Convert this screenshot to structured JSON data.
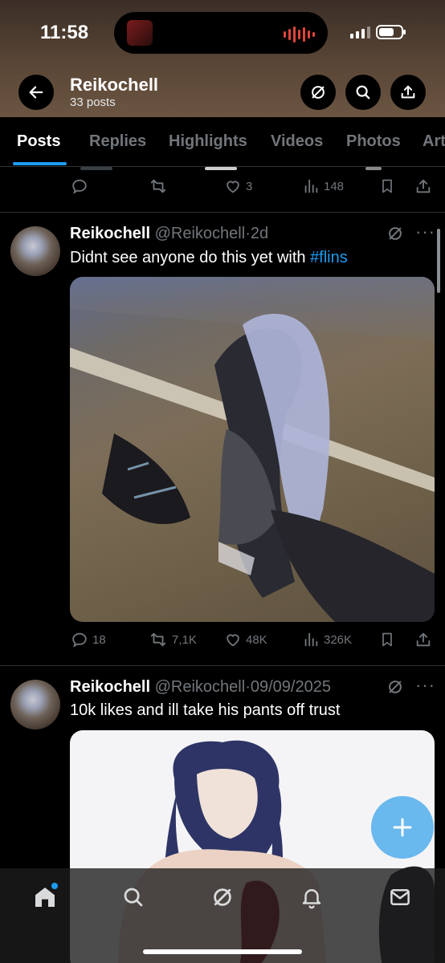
{
  "status_bar": {
    "time": "11:58"
  },
  "header": {
    "name": "Reikochell",
    "post_count": "33 posts"
  },
  "tabs": [
    {
      "label": "Posts",
      "active": true
    },
    {
      "label": "Replies",
      "active": false
    },
    {
      "label": "Highlights",
      "active": false
    },
    {
      "label": "Videos",
      "active": false
    },
    {
      "label": "Photos",
      "active": false
    },
    {
      "label": "Art",
      "active": false
    }
  ],
  "prev_post": {
    "replies": "",
    "reposts": "",
    "likes": "3",
    "views": "148"
  },
  "posts": [
    {
      "name": "Reikochell",
      "handle": "@Reikochell",
      "sep": "·",
      "time": "2d",
      "text": "Didnt see anyone do this yet with ",
      "hashtag": "#flins",
      "replies": "18",
      "reposts": "7,1K",
      "likes": "48K",
      "views": "326K"
    },
    {
      "name": "Reikochell",
      "handle": "@Reikochell",
      "sep": "·",
      "time": "09/09/2025",
      "text": "10k likes and ill take his pants off trust"
    }
  ],
  "colors": {
    "accent": "#1d9bf0",
    "fab": "#69b8ee",
    "muted": "#71767b",
    "divider": "#2f3336"
  },
  "icons": {
    "back": "arrow-left-icon",
    "grok": "grok-icon",
    "search": "search-icon",
    "share": "share-icon",
    "reply": "reply-icon",
    "repost": "repost-icon",
    "like": "heart-icon",
    "views": "views-icon",
    "bookmark": "bookmark-icon",
    "compose": "plus-icon",
    "home": "home-icon",
    "notifications": "bell-icon",
    "messages": "mail-icon"
  }
}
